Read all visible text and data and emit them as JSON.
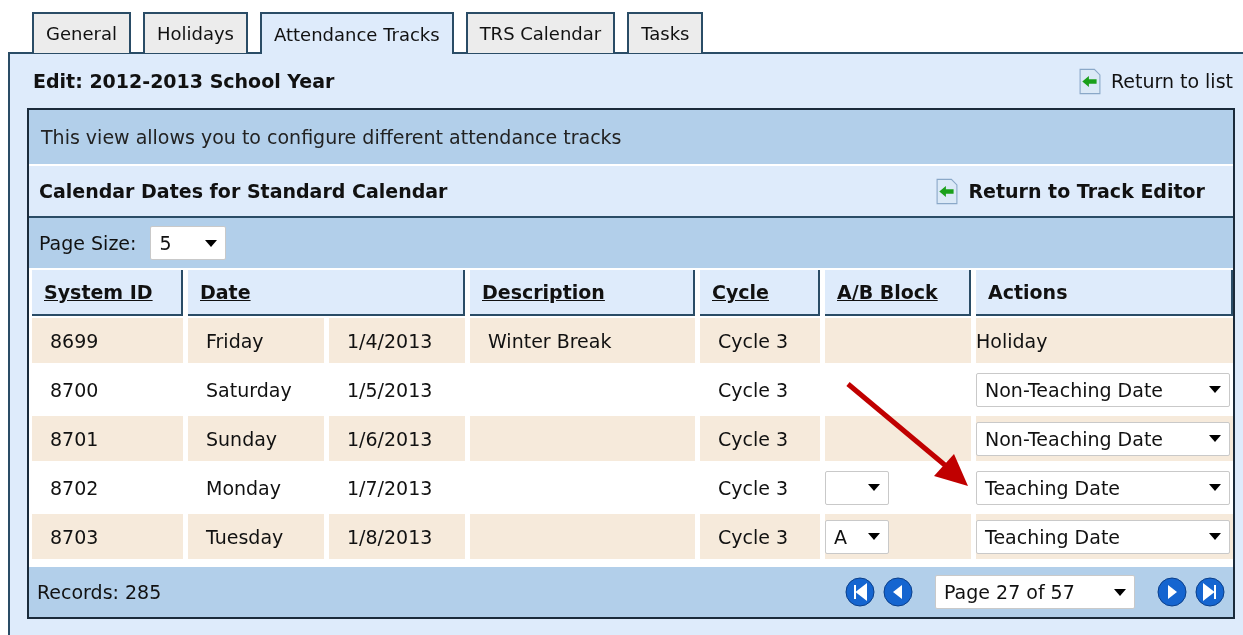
{
  "tabs": [
    {
      "label": "General",
      "selected": false
    },
    {
      "label": "Holidays",
      "selected": false
    },
    {
      "label": "Attendance Tracks",
      "selected": true
    },
    {
      "label": "TRS Calendar",
      "selected": false
    },
    {
      "label": "Tasks",
      "selected": false
    }
  ],
  "panel": {
    "title": "Edit: 2012-2013 School Year",
    "return_link": "Return to list"
  },
  "info": "This view allows you to configure different attendance tracks",
  "grid": {
    "title": "Calendar Dates for Standard Calendar",
    "return_link": "Return to Track Editor",
    "page_size_label": "Page Size:",
    "page_size": "5",
    "columns": [
      {
        "label": "System ID",
        "sortable": true
      },
      {
        "label": "Date",
        "sortable": true
      },
      {
        "label": "Description",
        "sortable": true
      },
      {
        "label": "Cycle",
        "sortable": true
      },
      {
        "label": "A/B Block",
        "sortable": true
      },
      {
        "label": "Actions",
        "sortable": false
      }
    ],
    "rows": [
      {
        "id": "8699",
        "day": "Friday",
        "date": "1/4/2013",
        "description": "Winter Break",
        "cycle": "Cycle 3",
        "action": {
          "kind": "text",
          "value": "Holiday"
        }
      },
      {
        "id": "8700",
        "day": "Saturday",
        "date": "1/5/2013",
        "cycle": "Cycle 3",
        "action": {
          "kind": "select",
          "value": "Non-Teaching Date"
        }
      },
      {
        "id": "8701",
        "day": "Sunday",
        "date": "1/6/2013",
        "cycle": "Cycle 3",
        "action": {
          "kind": "select",
          "value": "Non-Teaching Date"
        }
      },
      {
        "id": "8702",
        "day": "Monday",
        "date": "1/7/2013",
        "cycle": "Cycle 3",
        "ab_block": {
          "kind": "select"
        },
        "action": {
          "kind": "select",
          "value": "Teaching Date"
        }
      },
      {
        "id": "8703",
        "day": "Tuesday",
        "date": "1/8/2013",
        "cycle": "Cycle 3",
        "ab_block": {
          "kind": "select",
          "value": "A"
        },
        "action": {
          "kind": "select",
          "value": "Teaching Date"
        }
      }
    ],
    "records": "Records: 285",
    "page": "Page 27 of 57"
  }
}
